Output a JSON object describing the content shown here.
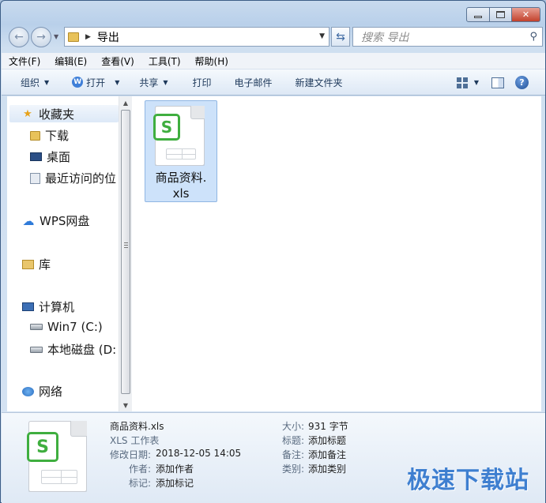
{
  "window": {
    "caption_minimize": "▭",
    "caption_maximize": "▢",
    "caption_close": "✕"
  },
  "address": {
    "path": "导出",
    "search_placeholder": "搜索 导出"
  },
  "menu": [
    "文件(F)",
    "编辑(E)",
    "查看(V)",
    "工具(T)",
    "帮助(H)"
  ],
  "toolbar": {
    "organize": "组织",
    "open": "打开",
    "share": "共享",
    "print": "打印",
    "email": "电子邮件",
    "new_folder": "新建文件夹"
  },
  "nav": {
    "favorites": "收藏夹",
    "downloads": "下载",
    "desktop": "桌面",
    "recent": "最近访问的位",
    "wps_cloud": "WPS网盘",
    "libraries": "库",
    "computer": "计算机",
    "drive_c": "Win7 (C:)",
    "drive_d": "本地磁盘 (D:",
    "network": "网络"
  },
  "file": {
    "name_line1": "商品资料.",
    "name_line2": "xls",
    "badge_letter": "S"
  },
  "details": {
    "filename": "商品资料.xls",
    "type": "XLS 工作表",
    "modified_label": "修改日期:",
    "modified_value": "2018-12-05 14:05",
    "author_label": "作者:",
    "author_value": "添加作者",
    "tags_label": "标记:",
    "tags_value": "添加标记",
    "size_label": "大小:",
    "size_value": "931 字节",
    "title_label": "标题:",
    "title_value": "添加标题",
    "comments_label": "备注:",
    "comments_value": "添加备注",
    "category_label": "类别:",
    "category_value": "添加类别"
  },
  "watermark": "极速下载站",
  "colors": {
    "accent": "#3fae3f",
    "selection": "#cde2fa",
    "watermark": "#3e7fd0"
  }
}
